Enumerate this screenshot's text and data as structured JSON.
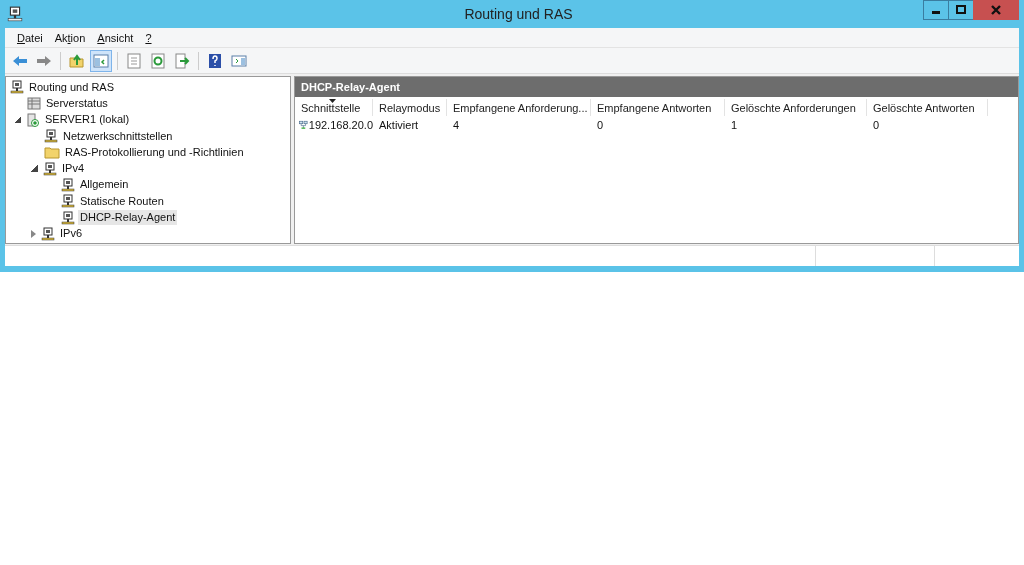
{
  "window": {
    "title": "Routing und RAS"
  },
  "menu": [
    {
      "key": "D",
      "after": "atei"
    },
    {
      "before": "Ak",
      "key": "t",
      "after": "ion"
    },
    {
      "key": "A",
      "after": "nsicht"
    },
    {
      "key": "?"
    }
  ],
  "toolbar": [
    [
      {
        "kind": "back",
        "pressed": false
      },
      {
        "kind": "forward",
        "pressed": false
      }
    ],
    [
      {
        "kind": "up",
        "pressed": false
      },
      {
        "kind": "tree",
        "pressed": true
      }
    ],
    [
      {
        "kind": "props",
        "pressed": false
      },
      {
        "kind": "refresh",
        "pressed": false
      },
      {
        "kind": "export",
        "pressed": false
      }
    ],
    [
      {
        "kind": "help",
        "pressed": false
      },
      {
        "kind": "pane",
        "pressed": false
      }
    ]
  ],
  "tree": [
    {
      "label": "Routing und RAS",
      "kind": "network",
      "selected": false,
      "children": [
        {
          "label": "Serverstatus",
          "kind": "status",
          "selected": false
        },
        {
          "label": "SERVER1 (lokal)",
          "kind": "server",
          "selected": false,
          "expanded": true,
          "children": [
            {
              "label": "Netzwerkschnittstellen",
              "kind": "network",
              "selected": false
            },
            {
              "label": "RAS-Protokollierung und -Richtlinien",
              "kind": "folder",
              "selected": false
            },
            {
              "label": "IPv4",
              "kind": "network",
              "selected": false,
              "expanded": true,
              "children": [
                {
                  "label": "Allgemein",
                  "kind": "network",
                  "selected": false
                },
                {
                  "label": "Statische Routen",
                  "kind": "network",
                  "selected": false
                },
                {
                  "label": "DHCP-Relay-Agent",
                  "kind": "network",
                  "selected": true
                }
              ]
            },
            {
              "label": "IPv6",
              "kind": "network",
              "selected": false,
              "expanded": false
            }
          ]
        }
      ]
    }
  ],
  "panel": {
    "title": "DHCP-Relay-Agent",
    "table": {
      "columns": [
        {
          "label": "Schnittstelle",
          "sorted": true
        },
        {
          "label": "Relaymodus",
          "sorted": false
        },
        {
          "label": "Empfangene Anforderung...",
          "sorted": false
        },
        {
          "label": "Empfangene Antworten",
          "sorted": false
        },
        {
          "label": "Gelöschte Anforderungen",
          "sorted": false
        },
        {
          "label": "Gelöschte Antworten",
          "sorted": false
        }
      ],
      "rows": [
        [
          "192.168.20.0",
          "Aktiviert",
          "4",
          "0",
          "1",
          "0"
        ]
      ]
    }
  }
}
